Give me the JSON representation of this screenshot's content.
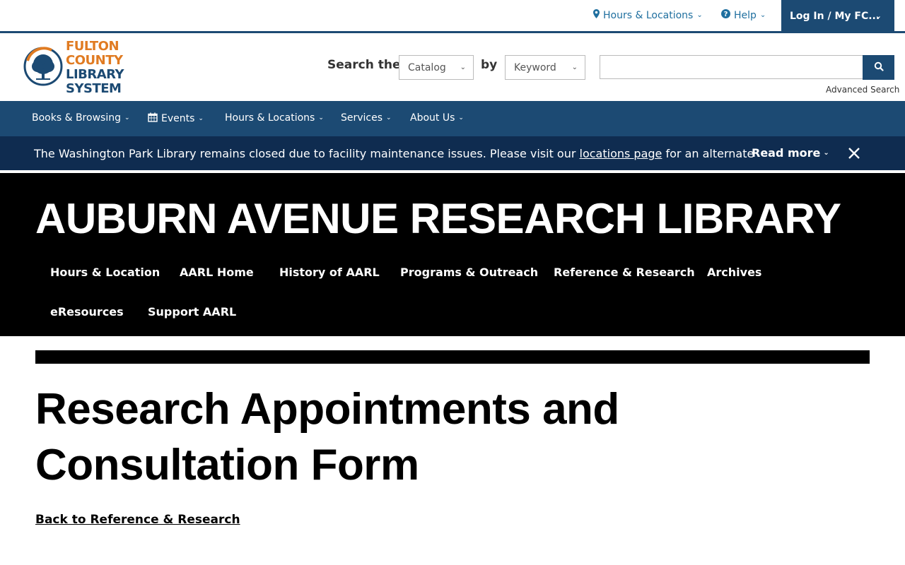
{
  "utility": {
    "hours_label": "Hours & Locations",
    "help_label": "Help",
    "login_label": "Log In / My FC..."
  },
  "logo": {
    "line1": "FULTON COUNTY",
    "line2": "LIBRARY SYSTEM"
  },
  "search": {
    "label": "Search the",
    "by_label": "by",
    "scope_value": "Catalog",
    "type_value": "Keyword",
    "query_value": "",
    "advanced_label": "Advanced Search"
  },
  "main_nav": [
    {
      "label": "Books & Browsing"
    },
    {
      "label": "Events"
    },
    {
      "label": "Hours & Locations"
    },
    {
      "label": "Services"
    },
    {
      "label": "About Us"
    }
  ],
  "alert": {
    "text_before": "The Washington Park Library remains closed due to facility maintenance issues. Please visit our ",
    "link_text": "locations page",
    "text_after": " for an alternate",
    "read_more_label": "Read more"
  },
  "banner": {
    "title": "AUBURN AVENUE RESEARCH LIBRARY",
    "nav": [
      {
        "label": "Hours & Location"
      },
      {
        "label": "AARL Home"
      },
      {
        "label": "History of AARL"
      },
      {
        "label": "Programs & Outreach"
      },
      {
        "label": "Reference & Research"
      },
      {
        "label": "Archives"
      },
      {
        "label": "eResources"
      },
      {
        "label": "Support AARL"
      }
    ]
  },
  "page": {
    "title": "Research Appointments and Consultation Form",
    "back_link": "Back to Reference & Research"
  },
  "colors": {
    "brand_blue": "#1c4a73",
    "alert_navy": "#0f2c50",
    "brand_orange": "#e07b22",
    "link_blue": "#1f6f9f"
  }
}
